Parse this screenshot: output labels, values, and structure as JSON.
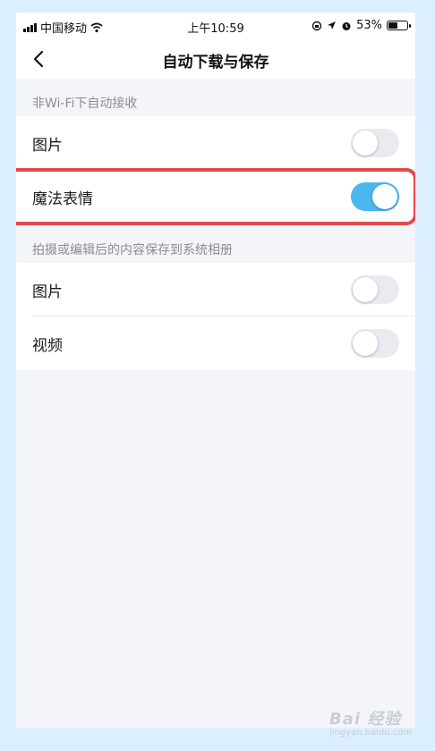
{
  "status_bar": {
    "carrier": "中国移动",
    "time": "上午10:59",
    "battery": "53%",
    "battery_level": 0.53
  },
  "nav": {
    "title": "自动下载与保存"
  },
  "sections": [
    {
      "header": "非Wi-Fi下自动接收",
      "rows": [
        {
          "label": "图片",
          "enabled": false
        },
        {
          "label": "魔法表情",
          "enabled": true
        }
      ]
    },
    {
      "header": "拍摄或编辑后的内容保存到系统相册",
      "rows": [
        {
          "label": "图片",
          "enabled": false
        },
        {
          "label": "视频",
          "enabled": false
        }
      ]
    }
  ],
  "watermark": {
    "brand": "Bai 经验",
    "url": "jingyan.baidu.com"
  },
  "colors": {
    "toggle_on": "#4ab7ef",
    "toggle_off": "#eaebf0",
    "highlight": "#e24a4a"
  }
}
